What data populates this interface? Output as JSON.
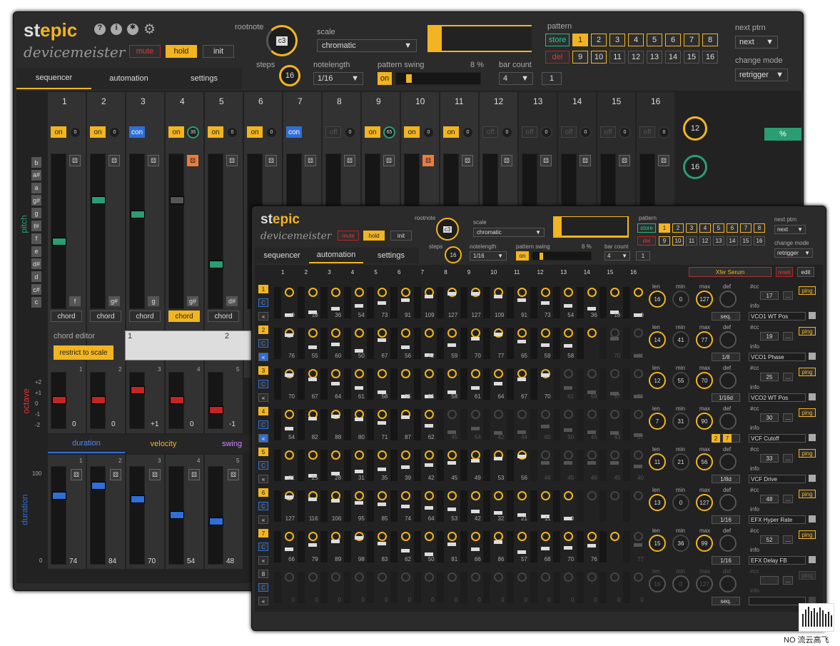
{
  "main": {
    "logo_a": "st",
    "logo_b": "epic",
    "subtitle": "devicemeister",
    "buttons": {
      "mute": "mute",
      "hold": "hold",
      "init": "init"
    },
    "rootnote_label": "rootnote",
    "rootnote": "c3",
    "steps_label": "steps",
    "steps": "16",
    "scale_label": "scale",
    "scale": "chromatic",
    "notelength_label": "notelength",
    "notelength": "1/16",
    "swing_label": "pattern swing",
    "swing_pct": "8 %",
    "swing_on": "on",
    "barcount_label": "bar count",
    "barcount": "4",
    "barcount_val": "1",
    "pattern_label": "pattern",
    "store": "store",
    "del": "del",
    "pattern_row1": [
      "1",
      "2",
      "3",
      "4",
      "5",
      "6",
      "7",
      "8"
    ],
    "pattern_row2": [
      "9",
      "10",
      "11",
      "12",
      "13",
      "14",
      "15",
      "16"
    ],
    "next_label": "next ptrn",
    "next": "next",
    "change_label": "change mode",
    "change": "retrigger",
    "tabs": [
      "sequencer",
      "automation",
      "settings"
    ],
    "steps_hdr": [
      "1",
      "2",
      "3",
      "4",
      "5",
      "6",
      "7",
      "8",
      "9",
      "10",
      "11",
      "12",
      "13",
      "14",
      "15",
      "16"
    ],
    "on_states": [
      "on",
      "on",
      "con",
      "on",
      "on",
      "on",
      "con",
      "off",
      "on",
      "on",
      "on",
      "off",
      "off",
      "off",
      "off",
      "off"
    ],
    "on_knob": [
      "0",
      "0",
      "",
      "35",
      "0",
      "0",
      "",
      "0",
      "65",
      "0",
      "0",
      "0",
      "0",
      "0",
      "0",
      "0"
    ],
    "pitch_label": "pitch",
    "pitch_keys": [
      "b",
      "a#",
      "a",
      "g#",
      "g",
      "f#",
      "f",
      "e",
      "d#",
      "d",
      "c#",
      "c"
    ],
    "step_notes": [
      "f",
      "g#",
      "g",
      "g#",
      "d#"
    ],
    "chord": "chord",
    "chord_editor": "chord editor",
    "restrict": "restrict to scale",
    "chord_nums": [
      "1",
      "2"
    ],
    "octave_label": "octave",
    "octave_vals": [
      "0",
      "0",
      "+1",
      "0",
      "-1"
    ],
    "octave_ticks": [
      "+2",
      "+1",
      "0",
      "-1",
      "-2"
    ],
    "col_nums": [
      "1",
      "2",
      "3",
      "4",
      "5"
    ],
    "bottom_tabs": [
      "duration",
      "velocity",
      "swing"
    ],
    "duration_label": "duration",
    "duration_vals": [
      "74",
      "84",
      "70",
      "54",
      "48"
    ],
    "duration_ticks": [
      "100",
      "0"
    ],
    "right_knobs": [
      "12",
      "16"
    ],
    "pct": "%",
    "c": "C"
  },
  "auto": {
    "logo_a": "st",
    "logo_b": "epic",
    "subtitle": "devicemeister",
    "buttons": {
      "mute": "mute",
      "hold": "hold",
      "init": "init"
    },
    "rootnote_label": "rootnote",
    "rootnote": "c3",
    "steps_label": "steps",
    "steps": "16",
    "scale_label": "scale",
    "scale": "chromatic",
    "notelength_label": "notelength",
    "notelength": "1/16",
    "swing_label": "pattern swing",
    "swing_pct": "8 %",
    "swing_on": "on",
    "barcount_label": "bar count",
    "barcount": "4",
    "barcount_val": "1",
    "pattern_label": "pattern",
    "store": "store",
    "del": "del",
    "pattern_row1": [
      "1",
      "2",
      "3",
      "4",
      "5",
      "6",
      "7",
      "8"
    ],
    "pattern_row2": [
      "9",
      "10",
      "11",
      "12",
      "13",
      "14",
      "15",
      "16"
    ],
    "next_label": "next ptrn",
    "next": "next",
    "change_label": "change mode",
    "change": "retrigger",
    "tabs": [
      "sequencer",
      "automation",
      "settings"
    ],
    "steps_hdr": [
      "1",
      "2",
      "3",
      "4",
      "5",
      "6",
      "7",
      "8",
      "9",
      "10",
      "11",
      "12",
      "13",
      "14",
      "15",
      "16"
    ],
    "device": "Xfer Serum",
    "reset": "reset",
    "edit": "edit",
    "lanes": [
      {
        "n": "1",
        "vals": [
          "0",
          "18",
          "36",
          "54",
          "73",
          "91",
          "109",
          "127",
          "127",
          "109",
          "91",
          "73",
          "54",
          "36",
          "18",
          "0"
        ],
        "len": "16",
        "min": "0",
        "max": "127",
        "cc": "17",
        "rate": "seq.",
        "name": "VCO1 WT Pos"
      },
      {
        "n": "2",
        "vals": [
          "76",
          "55",
          "60",
          "50",
          "67",
          "56",
          "42",
          "59",
          "70",
          "77",
          "65",
          "59",
          "58",
          "",
          "70",
          "41"
        ],
        "len": "14",
        "min": "41",
        "max": "77",
        "cc": "19",
        "rate": "1/8",
        "name": "VCO1 Phase"
      },
      {
        "n": "3",
        "vals": [
          "70",
          "67",
          "64",
          "61",
          "58",
          "55",
          "55",
          "58",
          "61",
          "64",
          "67",
          "70",
          "61",
          "58",
          "57",
          "55"
        ],
        "len": "12",
        "min": "55",
        "max": "70",
        "cc": "25",
        "rate": "1/16d",
        "name": "VCO2 WT Pos"
      },
      {
        "n": "4",
        "vals": [
          "54",
          "82",
          "88",
          "80",
          "71",
          "87",
          "62",
          "45",
          "54",
          "42",
          "44",
          "60",
          "50",
          "45",
          "43",
          "37"
        ],
        "len": "7",
        "min": "31",
        "max": "90",
        "cc": "30",
        "rate": "",
        "name": "VCF Cutoff"
      },
      {
        "n": "5",
        "vals": [
          "21",
          "25",
          "28",
          "31",
          "35",
          "39",
          "42",
          "45",
          "49",
          "53",
          "56",
          "46",
          "45",
          "46",
          "45",
          "40"
        ],
        "len": "11",
        "min": "21",
        "max": "56",
        "cc": "33",
        "rate": "1/8d",
        "name": "VCF Drive"
      },
      {
        "n": "6",
        "vals": [
          "127",
          "116",
          "106",
          "95",
          "85",
          "74",
          "64",
          "53",
          "42",
          "32",
          "21",
          "11",
          "0",
          "",
          "",
          ""
        ],
        "len": "13",
        "min": "0",
        "max": "127",
        "cc": "48",
        "rate": "1/16",
        "name": "EFX Hyper Rate"
      },
      {
        "n": "7",
        "vals": [
          "66",
          "79",
          "89",
          "98",
          "83",
          "62",
          "50",
          "81",
          "66",
          "86",
          "57",
          "68",
          "70",
          "76",
          "",
          "77"
        ],
        "len": "15",
        "min": "36",
        "max": "99",
        "cc": "52",
        "rate": "1/16",
        "name": "EFX Delay FB"
      },
      {
        "n": "8",
        "vals": [
          "0",
          "0",
          "0",
          "0",
          "0",
          "0",
          "0",
          "0",
          "0",
          "0",
          "0",
          "0",
          "0",
          "0",
          "0",
          "0"
        ],
        "len": "16",
        "min": "0",
        "max": "127",
        "cc": "",
        "rate": "seq.",
        "name": ""
      }
    ],
    "lbl_len": "len",
    "lbl_min": "min",
    "lbl_max": "max",
    "lbl_def": "def",
    "lbl_cc": "#cc",
    "lbl_info": "info",
    "ping": "ping",
    "dots": "...",
    "rate_extra": [
      "2",
      "7"
    ]
  },
  "watermark": "NO 流云高飞"
}
